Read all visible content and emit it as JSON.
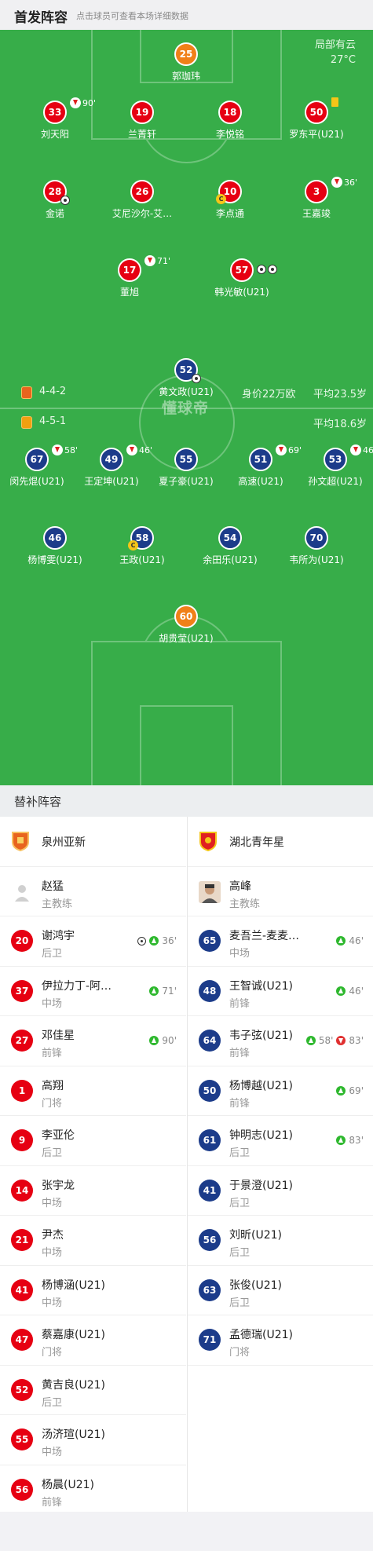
{
  "header": {
    "title": "首发阵容",
    "hint": "点击球员可查看本场详细数据"
  },
  "weather": {
    "condition": "局部有云",
    "temp": "27°C"
  },
  "watermark": "懂球帝",
  "home_info": {
    "formation": "4-4-2",
    "value": "身价22万欧",
    "age": "平均23.5岁"
  },
  "away_info": {
    "formation": "4-5-1",
    "age": "平均18.6岁"
  },
  "home_players": [
    {
      "num": "25",
      "name": "郭珈玮",
      "color": "org"
    },
    {
      "num": "33",
      "name": "刘天阳",
      "color": "red",
      "sub": "90'"
    },
    {
      "num": "19",
      "name": "兰菁轩",
      "color": "red"
    },
    {
      "num": "18",
      "name": "李悦铭",
      "color": "red"
    },
    {
      "num": "50",
      "name": "罗东平(U21)",
      "color": "red",
      "card": "yellow"
    },
    {
      "num": "28",
      "name": "金诺",
      "color": "red",
      "goal": true
    },
    {
      "num": "26",
      "name": "艾尼沙尔-艾…",
      "color": "red"
    },
    {
      "num": "10",
      "name": "李点通",
      "color": "red",
      "captain": "C"
    },
    {
      "num": "3",
      "name": "王嘉竣",
      "color": "red",
      "sub": "36'"
    },
    {
      "num": "17",
      "name": "董旭",
      "color": "red",
      "sub": "71'"
    },
    {
      "num": "57",
      "name": "韩光敏(U21)",
      "color": "red",
      "goals": 2
    }
  ],
  "away_players": [
    {
      "num": "52",
      "name": "黄文政(U21)",
      "color": "blue",
      "goal": true
    },
    {
      "num": "67",
      "name": "闵先焜(U21)",
      "color": "blue",
      "sub": "58'"
    },
    {
      "num": "49",
      "name": "王定坤(U21)",
      "color": "blue",
      "sub": "46'"
    },
    {
      "num": "55",
      "name": "夏子豪(U21)",
      "color": "blue"
    },
    {
      "num": "51",
      "name": "高速(U21)",
      "color": "blue",
      "sub": "69'"
    },
    {
      "num": "53",
      "name": "孙文超(U21)",
      "color": "blue",
      "sub": "46'"
    },
    {
      "num": "46",
      "name": "杨博雯(U21)",
      "color": "blue"
    },
    {
      "num": "58",
      "name": "王政(U21)",
      "color": "blue",
      "captain": "C"
    },
    {
      "num": "54",
      "name": "余田乐(U21)",
      "color": "blue"
    },
    {
      "num": "70",
      "name": "韦所为(U21)",
      "color": "blue"
    },
    {
      "num": "60",
      "name": "胡贵莹(U21)",
      "color": "org"
    }
  ],
  "subs_title": "替补阵容",
  "home_team": "泉州亚新",
  "away_team": "湖北青年星",
  "home_coach": {
    "name": "赵猛",
    "role": "主教练"
  },
  "away_coach": {
    "name": "高峰",
    "role": "主教练"
  },
  "home_subs": [
    {
      "num": "20",
      "name": "谢鸿宇",
      "pos": "后卫",
      "goal": true,
      "in": "36'"
    },
    {
      "num": "37",
      "name": "伊拉力丁-阿…",
      "pos": "中场",
      "in": "71'"
    },
    {
      "num": "27",
      "name": "邓佳星",
      "pos": "前锋",
      "in": "90'"
    },
    {
      "num": "1",
      "name": "高翔",
      "pos": "门将"
    },
    {
      "num": "9",
      "name": "李亚伦",
      "pos": "后卫"
    },
    {
      "num": "14",
      "name": "张宇龙",
      "pos": "中场"
    },
    {
      "num": "21",
      "name": "尹杰",
      "pos": "中场"
    },
    {
      "num": "41",
      "name": "杨博涵(U21)",
      "pos": "中场"
    },
    {
      "num": "47",
      "name": "蔡嘉康(U21)",
      "pos": "门将"
    },
    {
      "num": "52",
      "name": "黄吉良(U21)",
      "pos": "后卫"
    },
    {
      "num": "55",
      "name": "汤济瑄(U21)",
      "pos": "中场"
    },
    {
      "num": "56",
      "name": "杨晨(U21)",
      "pos": "前锋"
    }
  ],
  "away_subs": [
    {
      "num": "65",
      "name": "麦吾兰-麦麦…",
      "pos": "中场",
      "in": "46'"
    },
    {
      "num": "48",
      "name": "王智诚(U21)",
      "pos": "前锋",
      "in": "46'"
    },
    {
      "num": "64",
      "name": "韦子弦(U21)",
      "pos": "前锋",
      "in": "58'",
      "out": "83'"
    },
    {
      "num": "50",
      "name": "杨博越(U21)",
      "pos": "前锋",
      "in": "69'"
    },
    {
      "num": "61",
      "name": "钟明志(U21)",
      "pos": "后卫",
      "in": "83'"
    },
    {
      "num": "41",
      "name": "于景澄(U21)",
      "pos": "后卫"
    },
    {
      "num": "56",
      "name": "刘昕(U21)",
      "pos": "后卫"
    },
    {
      "num": "63",
      "name": "张俊(U21)",
      "pos": "后卫"
    },
    {
      "num": "71",
      "name": "孟德瑞(U21)",
      "pos": "门将"
    }
  ],
  "colors": {
    "pitch": "#37ad49",
    "home": "#e60012",
    "away": "#1c3c8a",
    "keeper": "#f08018"
  }
}
